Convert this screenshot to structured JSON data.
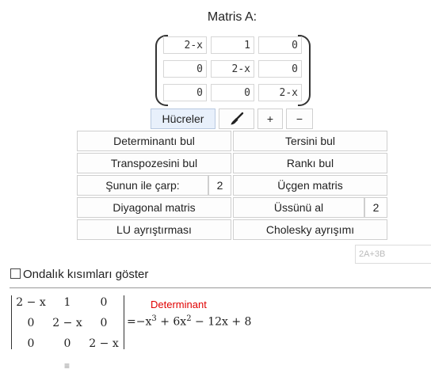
{
  "matrix": {
    "title": "Matris A:",
    "cells": [
      [
        "2-x",
        "1",
        "0"
      ],
      [
        "0",
        "2-x",
        "0"
      ],
      [
        "0",
        "0",
        "2-x"
      ]
    ]
  },
  "toolbar": {
    "cells_label": "Hücreler",
    "clear_icon": "brush-icon",
    "plus_label": "+",
    "minus_label": "−"
  },
  "actions": {
    "determinant": "Determinantı bul",
    "inverse": "Tersini bul",
    "transpose": "Transpozesini bul",
    "rank": "Rankı bul",
    "multiply": "Şunun ile çarp:",
    "multiply_value": "2",
    "triangular": "Üçgen matris",
    "diagonal": "Diyagonal matris",
    "power": "Üssünü al",
    "power_value": "2",
    "lu": "LU ayrıştırması",
    "cholesky": "Cholesky ayrışımı"
  },
  "expression": {
    "placeholder": "2A+3B"
  },
  "options": {
    "decimals_label": "Ondalık kısımları göster",
    "decimals_checked": false
  },
  "result": {
    "label": "Determinant",
    "rows": [
      [
        "2 − x",
        "1",
        "0"
      ],
      [
        "0",
        "2 − x",
        "0"
      ],
      [
        "0",
        "0",
        "2 − x"
      ]
    ],
    "equals": "=",
    "polynomial": {
      "t1": "−x",
      "e1": "3",
      "t2": " + 6x",
      "e2": "2",
      "t3": " − 12x + 8"
    },
    "grip_icon": "drag-handle-icon"
  }
}
